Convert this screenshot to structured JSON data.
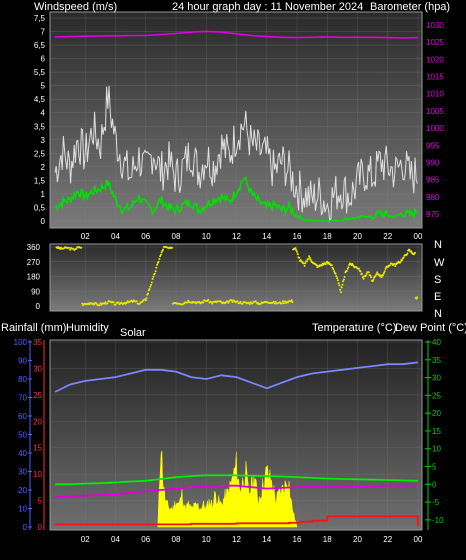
{
  "header": {
    "left": "Windspeed (m/s)",
    "center": "24 hour graph day : 11 November 2024",
    "right": "Barometer (hpa)"
  },
  "labels": {
    "rainfall": "Rainfall (mm)",
    "humidity": "Humidity",
    "solar": "Solar",
    "temperature": "Temperature (°C)",
    "dewpoint": "Dew Point (°C)"
  },
  "compass": [
    "N",
    "W",
    "S",
    "E",
    "N"
  ],
  "colors": {
    "wind_gust": "#e0e0e0",
    "wind_avg": "#00e000",
    "barometer": "#e000e0",
    "direction": "#e8e800",
    "humidity": "#7a86ff",
    "temperature": "#00ee00",
    "dewpoint": "#dd00dd",
    "solar": "#ffff00",
    "rain": "#ff1010",
    "rain_axis": "#ff3030",
    "humidity_axis": "#5060ff",
    "temp_axis": "#00d000"
  },
  "chart_data": [
    {
      "type": "line",
      "title": "24 hour graph day : 11 November 2024",
      "ylabel": "Windspeed (m/s)",
      "y2label": "Barometer (hpa)",
      "xlim": [
        0,
        24
      ],
      "ylim": [
        0,
        7.5
      ],
      "y2lim": [
        973,
        1032
      ],
      "x_ticks": [
        "02",
        "04",
        "06",
        "08",
        "10",
        "12",
        "14",
        "16",
        "18",
        "20",
        "22",
        "00"
      ],
      "y_ticks": [
        "0",
        "0,5",
        "1",
        "1,5",
        "2",
        "2,5",
        "3",
        "3,5",
        "4",
        "4,5",
        "5",
        "5,5",
        "6",
        "6,5",
        "7",
        "7,5"
      ],
      "y2_ticks": [
        "975",
        "980",
        "985",
        "990",
        "995",
        "1000",
        "1005",
        "1010",
        "1015",
        "1020",
        "1025",
        "1030"
      ],
      "series": [
        {
          "name": "Barometer (hpa)",
          "axis": "right",
          "x": [
            0,
            1,
            2,
            3,
            4,
            5,
            6,
            7,
            8,
            9,
            10,
            11,
            12,
            13,
            14,
            15,
            16,
            17,
            18,
            19,
            20,
            21,
            22,
            23,
            24
          ],
          "values": [
            1026.5,
            1026.6,
            1026.7,
            1026.8,
            1026.8,
            1026.9,
            1026.9,
            1027.2,
            1027.5,
            1027.9,
            1028.1,
            1027.9,
            1027.4,
            1026.9,
            1026.6,
            1026.4,
            1026.3,
            1026.4,
            1026.5,
            1026.4,
            1026.4,
            1026.4,
            1026.3,
            1026.2,
            1026.3
          ]
        },
        {
          "name": "Wind gust",
          "axis": "left",
          "x": [
            0,
            0.5,
            1,
            1.5,
            2,
            2.5,
            3,
            3.5,
            4,
            4.5,
            5,
            5.5,
            6,
            6.5,
            7,
            7.5,
            8,
            8.5,
            9,
            9.5,
            10,
            10.5,
            11,
            11.5,
            12,
            12.5,
            13,
            13.5,
            14,
            14.5,
            15,
            15.5,
            16,
            16.5,
            17,
            17.5,
            18,
            18.5,
            19,
            19.5,
            20,
            20.5,
            21,
            21.5,
            22,
            22.5,
            23,
            23.5,
            24
          ],
          "values": [
            1.8,
            2.6,
            2.0,
            3.0,
            2.4,
            3.4,
            2.8,
            4.6,
            3.0,
            2.2,
            1.6,
            2.4,
            1.8,
            2.6,
            1.8,
            2.2,
            1.6,
            2.0,
            2.6,
            1.8,
            2.4,
            2.0,
            2.8,
            2.4,
            3.2,
            3.6,
            2.8,
            2.6,
            2.4,
            1.8,
            2.2,
            1.8,
            1.2,
            1.0,
            0.8,
            1.0,
            0.6,
            1.0,
            1.2,
            0.9,
            1.4,
            1.8,
            1.6,
            2.2,
            2.0,
            1.8,
            2.2,
            1.6,
            1.8
          ]
        },
        {
          "name": "Wind average",
          "axis": "left",
          "x": [
            0,
            0.5,
            1,
            1.5,
            2,
            2.5,
            3,
            3.5,
            4,
            4.5,
            5,
            5.5,
            6,
            6.5,
            7,
            7.5,
            8,
            8.5,
            9,
            9.5,
            10,
            10.5,
            11,
            11.5,
            12,
            12.5,
            13,
            13.5,
            14,
            14.5,
            15,
            15.5,
            16,
            16.5,
            17,
            17.5,
            18,
            18.5,
            19,
            19.5,
            20,
            20.5,
            21,
            21.5,
            22,
            22.5,
            23,
            23.5,
            24
          ],
          "values": [
            0.5,
            0.7,
            0.8,
            1.1,
            0.9,
            1.1,
            1.2,
            1.4,
            0.8,
            0.4,
            0.5,
            0.9,
            0.6,
            0.4,
            0.8,
            0.5,
            0.4,
            0.6,
            0.7,
            0.4,
            0.6,
            0.8,
            0.9,
            0.7,
            1.1,
            1.6,
            1.0,
            0.7,
            0.5,
            0.6,
            0.4,
            0.5,
            0.2,
            0.05,
            0.0,
            0.0,
            0.0,
            0.0,
            0.05,
            0.1,
            0.1,
            0.2,
            0.1,
            0.3,
            0.2,
            0.15,
            0.3,
            0.2,
            0.4
          ]
        }
      ]
    },
    {
      "type": "scatter",
      "ylabel": "Wind direction",
      "xlim": [
        0,
        24
      ],
      "ylim": [
        0,
        360
      ],
      "y_ticks": [
        "0",
        "90",
        "180",
        "270",
        "360"
      ],
      "series": [
        {
          "name": "Wind direction",
          "x": [
            0.1,
            0.4,
            0.8,
            1.2,
            1.6,
            2.0,
            2.4,
            2.8,
            3.2,
            3.6,
            4.0,
            4.4,
            4.8,
            5.2,
            5.6,
            6.0,
            6.3,
            6.6,
            6.9,
            7.2,
            7.6,
            8.0,
            8.4,
            8.8,
            9.2,
            9.6,
            10.0,
            10.4,
            10.8,
            11.2,
            11.6,
            12.0,
            12.4,
            12.8,
            13.2,
            13.6,
            14.0,
            14.4,
            14.8,
            15.2,
            15.6,
            15.9,
            16.2,
            16.5,
            16.8,
            17.1,
            17.4,
            17.7,
            18.0,
            18.3,
            18.6,
            18.9,
            19.2,
            19.5,
            19.8,
            20.1,
            20.4,
            20.7,
            21.0,
            21.3,
            21.6,
            21.9,
            22.2,
            22.5,
            22.8,
            23.1,
            23.4,
            23.7,
            24.0
          ],
          "values": [
            360,
            350,
            355,
            345,
            358,
            10,
            20,
            8,
            15,
            25,
            12,
            18,
            22,
            30,
            15,
            40,
            120,
            200,
            290,
            360,
            350,
            20,
            15,
            30,
            25,
            18,
            35,
            20,
            28,
            15,
            30,
            25,
            20,
            18,
            24,
            15,
            28,
            20,
            18,
            25,
            30,
            350,
            280,
            250,
            300,
            260,
            240,
            255,
            265,
            250,
            180,
            90,
            200,
            260,
            240,
            230,
            170,
            210,
            150,
            200,
            180,
            230,
            260,
            250,
            270,
            300,
            340,
            320,
            50
          ]
        }
      ]
    },
    {
      "type": "line",
      "ylabel": "Rainfall (mm)",
      "y2label": "Temperature (°C)",
      "xlim": [
        0,
        24
      ],
      "x_ticks": [
        "02",
        "04",
        "06",
        "08",
        "10",
        "12",
        "14",
        "16",
        "18",
        "20",
        "22",
        "00"
      ],
      "rain_ticks": [
        "0",
        "5",
        "10",
        "15",
        "20",
        "25",
        "30",
        "35"
      ],
      "humidity_ticks": [
        "0",
        "10",
        "20",
        "30",
        "40",
        "50",
        "60",
        "70",
        "80",
        "90",
        "100"
      ],
      "temp_ticks": [
        "-10",
        "-5",
        "0",
        "5",
        "10",
        "15",
        "20",
        "25",
        "30",
        "35",
        "40"
      ],
      "rain_ylim": [
        0,
        35
      ],
      "humidity_ylim": [
        0,
        100
      ],
      "temp_ylim": [
        -12,
        40
      ],
      "series": [
        {
          "name": "Humidity",
          "axis": "humidity",
          "x": [
            0,
            1,
            2,
            3,
            4,
            5,
            6,
            7,
            8,
            9,
            10,
            11,
            12,
            13,
            14,
            15,
            16,
            17,
            18,
            19,
            20,
            21,
            22,
            23,
            24
          ],
          "values": [
            73,
            77,
            79,
            80,
            81,
            83,
            85,
            85,
            84,
            81,
            80,
            82,
            81,
            78,
            75,
            78,
            81,
            83,
            84,
            85,
            86,
            87,
            88,
            88,
            89
          ]
        },
        {
          "name": "Temperature (°C)",
          "axis": "temp",
          "x": [
            0,
            1,
            2,
            3,
            4,
            5,
            6,
            7,
            8,
            9,
            10,
            11,
            12,
            13,
            14,
            15,
            16,
            17,
            18,
            19,
            20,
            21,
            22,
            23,
            24
          ],
          "values": [
            0,
            0,
            0.2,
            0.3,
            0.5,
            0.8,
            1,
            1.5,
            2,
            2.3,
            2.5,
            2.5,
            2.5,
            2.4,
            2.3,
            2.2,
            2.0,
            1.8,
            1.6,
            1.5,
            1.4,
            1.3,
            1.2,
            1.1,
            1.0
          ]
        },
        {
          "name": "Dew Point (°C)",
          "axis": "temp",
          "x": [
            0,
            1,
            2,
            3,
            4,
            5,
            6,
            7,
            8,
            9,
            10,
            11,
            12,
            13,
            14,
            15,
            16,
            17,
            18,
            19,
            20,
            21,
            22,
            23,
            24
          ],
          "values": [
            -3.6,
            -3.4,
            -3.2,
            -3.0,
            -2.8,
            -2.4,
            -2.0,
            -1.6,
            -1.2,
            -0.8,
            -0.6,
            -0.4,
            -0.4,
            -0.8,
            -1.2,
            -1.0,
            -0.8,
            -0.7,
            -0.6,
            -0.6,
            -0.5,
            -0.5,
            -0.4,
            -0.4,
            -0.3
          ]
        },
        {
          "name": "Solar",
          "axis": "humidity",
          "x": [
            6.8,
            7.0,
            7.1,
            7.2,
            7.3,
            7.4,
            7.6,
            7.8,
            8.0,
            8.2,
            8.4,
            8.6,
            8.8,
            9.0,
            9.2,
            9.4,
            9.6,
            9.8,
            10.0,
            10.2,
            10.4,
            10.6,
            10.8,
            11.0,
            11.2,
            11.4,
            11.6,
            11.8,
            12.0,
            12.2,
            12.4,
            12.6,
            12.8,
            13.0,
            13.2,
            13.4,
            13.6,
            13.8,
            14.0,
            14.2,
            14.4,
            14.6,
            14.8,
            15.0,
            15.2,
            15.4,
            15.6,
            15.8,
            16.0
          ],
          "values": [
            0,
            48,
            30,
            20,
            14,
            12,
            10,
            10,
            14,
            12,
            18,
            10,
            12,
            10,
            11,
            12,
            10,
            12,
            10,
            14,
            12,
            18,
            14,
            12,
            16,
            18,
            22,
            28,
            34,
            20,
            24,
            30,
            18,
            22,
            28,
            14,
            18,
            24,
            30,
            26,
            22,
            14,
            18,
            20,
            22,
            28,
            14,
            6,
            0
          ]
        },
        {
          "name": "Rainfall (mm)",
          "axis": "rain",
          "x": [
            0,
            7,
            9,
            12,
            15.5,
            16.2,
            17,
            18,
            19,
            20,
            21,
            22,
            23,
            23.9,
            24
          ],
          "values": [
            0.5,
            0.5,
            0.6,
            0.7,
            0.8,
            1.0,
            1.2,
            2.0,
            2.0,
            2.0,
            2.0,
            2.0,
            2.0,
            2.0,
            0.2
          ]
        }
      ]
    }
  ]
}
